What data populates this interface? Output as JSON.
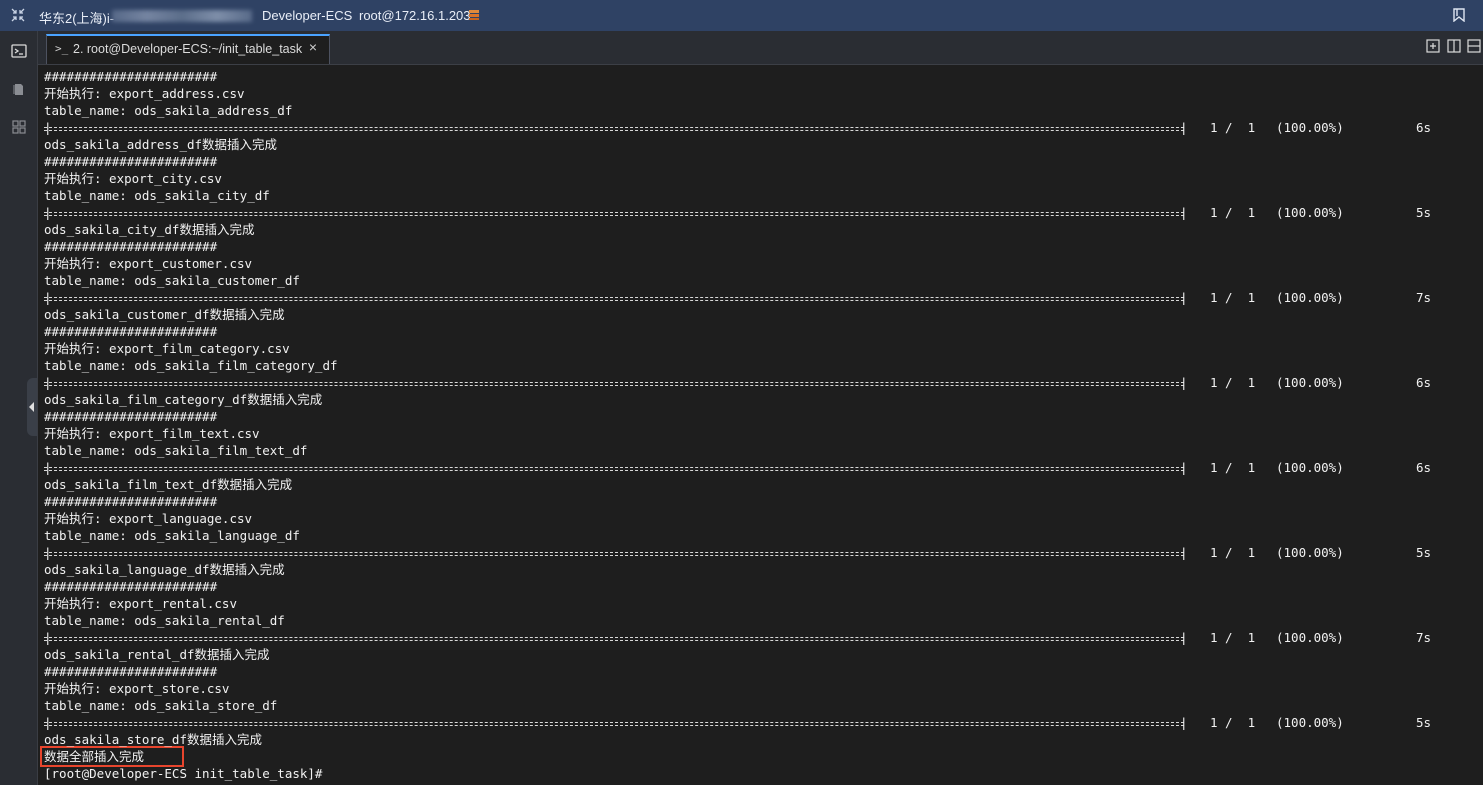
{
  "window": {
    "region": "华东2(上海)i-",
    "host": "Developer-ECS",
    "ip": "root@172.16.1.203"
  },
  "tab": {
    "prompt": ">_",
    "label": "2. root@Developer-ECS:~/init_table_task",
    "close": "×"
  },
  "progress_common": {
    "count": "1 /  1",
    "percent": "(100.00%)"
  },
  "tasks": [
    {
      "sep": "#######################",
      "start": "开始执行: export_address.csv",
      "table": "table_name: ods_sakila_address_df",
      "time": "6s",
      "done": "ods_sakila_address_df数据插入完成"
    },
    {
      "sep": "#######################",
      "start": "开始执行: export_city.csv",
      "table": "table_name: ods_sakila_city_df",
      "time": "5s",
      "done": "ods_sakila_city_df数据插入完成"
    },
    {
      "sep": "#######################",
      "start": "开始执行: export_customer.csv",
      "table": "table_name: ods_sakila_customer_df",
      "time": "7s",
      "done": "ods_sakila_customer_df数据插入完成"
    },
    {
      "sep": "#######################",
      "start": "开始执行: export_film_category.csv",
      "table": "table_name: ods_sakila_film_category_df",
      "time": "6s",
      "done": "ods_sakila_film_category_df数据插入完成"
    },
    {
      "sep": "#######################",
      "start": "开始执行: export_film_text.csv",
      "table": "table_name: ods_sakila_film_text_df",
      "time": "6s",
      "done": "ods_sakila_film_text_df数据插入完成"
    },
    {
      "sep": "#######################",
      "start": "开始执行: export_language.csv",
      "table": "table_name: ods_sakila_language_df",
      "time": "5s",
      "done": "ods_sakila_language_df数据插入完成"
    },
    {
      "sep": "#######################",
      "start": "开始执行: export_rental.csv",
      "table": "table_name: ods_sakila_rental_df",
      "time": "7s",
      "done": "ods_sakila_rental_df数据插入完成"
    },
    {
      "sep": "#######################",
      "start": "开始执行: export_store.csv",
      "table": "table_name: ods_sakila_store_df",
      "time": "5s",
      "done": "ods_sakila_store_df数据插入完成"
    }
  ],
  "final_message": "数据全部插入完成",
  "prompt_line": "[root@Developer-ECS init_table_task]#",
  "colors": {
    "titlebar": "#2f4264",
    "terminal_bg": "#1e1e1e",
    "highlight": "#e8452d",
    "tab_accent": "#4aa3ff"
  }
}
